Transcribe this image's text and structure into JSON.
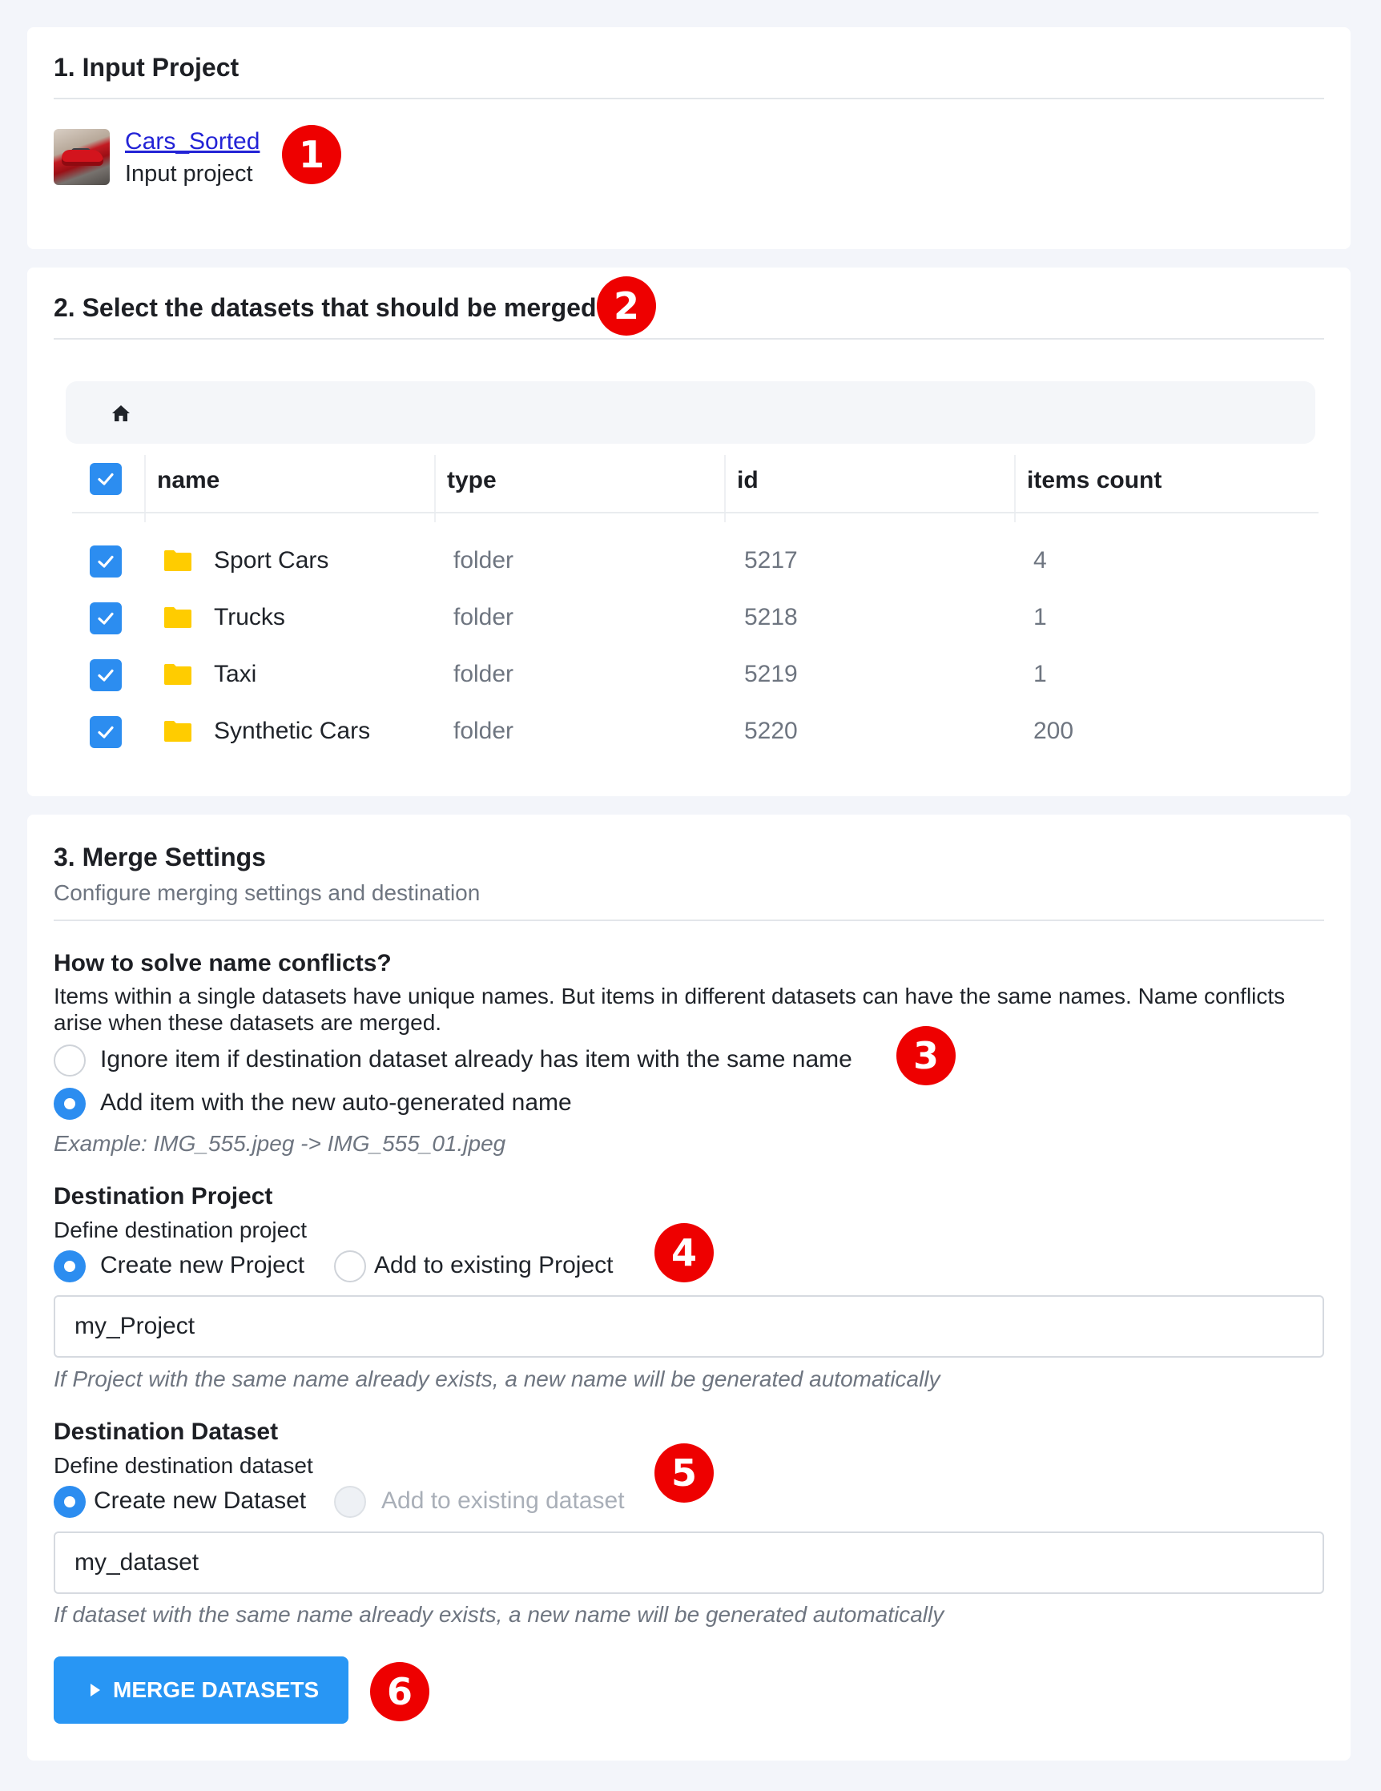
{
  "section1": {
    "title": "1. Input Project",
    "project_name": "Cars_Sorted",
    "project_sub": "Input project",
    "badge": "1"
  },
  "section2": {
    "title": "2. Select the datasets that should be merged",
    "badge": "2",
    "columns": [
      "name",
      "type",
      "id",
      "items count"
    ],
    "rows": [
      {
        "name": "Sport Cars",
        "type": "folder",
        "id": "5217",
        "count": "4",
        "checked": true
      },
      {
        "name": "Trucks",
        "type": "folder",
        "id": "5218",
        "count": "1",
        "checked": true
      },
      {
        "name": "Taxi",
        "type": "folder",
        "id": "5219",
        "count": "1",
        "checked": true
      },
      {
        "name": "Synthetic Cars",
        "type": "folder",
        "id": "5220",
        "count": "200",
        "checked": true
      }
    ],
    "icons": {
      "home": "home-icon",
      "folder": "folder-icon",
      "check": "checkmark-icon"
    },
    "folder_color": "#ffcc00",
    "check_color": "#2c8df0"
  },
  "section3": {
    "title": "3. Merge Settings",
    "subtitle": "Configure merging settings and destination",
    "conflicts": {
      "heading": "How to solve name conflicts?",
      "description": "Items within a single datasets have unique names. But items in different datasets can have the same names. Name conflicts arise when these datasets are merged.",
      "option_ignore": "Ignore item if destination dataset already has item with the same name",
      "option_add": "Add item with the new auto-generated name",
      "selected": "add",
      "example": "Example: IMG_555.jpeg -> IMG_555_01.jpeg",
      "badge": "3"
    },
    "dest_project": {
      "heading": "Destination Project",
      "description": "Define destination project",
      "option_new": "Create new Project",
      "option_existing": "Add to existing Project",
      "selected": "new",
      "value": "my_Project",
      "hint": "If Project with the same name already exists, a new name will be generated automatically",
      "badge": "4"
    },
    "dest_dataset": {
      "heading": "Destination Dataset",
      "description": "Define destination dataset",
      "option_new": "Create new Dataset",
      "option_existing": "Add to existing dataset",
      "selected": "new",
      "value": "my_dataset",
      "hint": "If dataset with the same name already exists, a new name will be generated automatically",
      "badge": "5"
    },
    "button": {
      "label": "MERGE DATASETS",
      "icon": "play-icon",
      "badge": "6"
    }
  },
  "colors": {
    "accent": "#2896f4",
    "badge": "#ee0000",
    "background": "#f3f5fa"
  }
}
